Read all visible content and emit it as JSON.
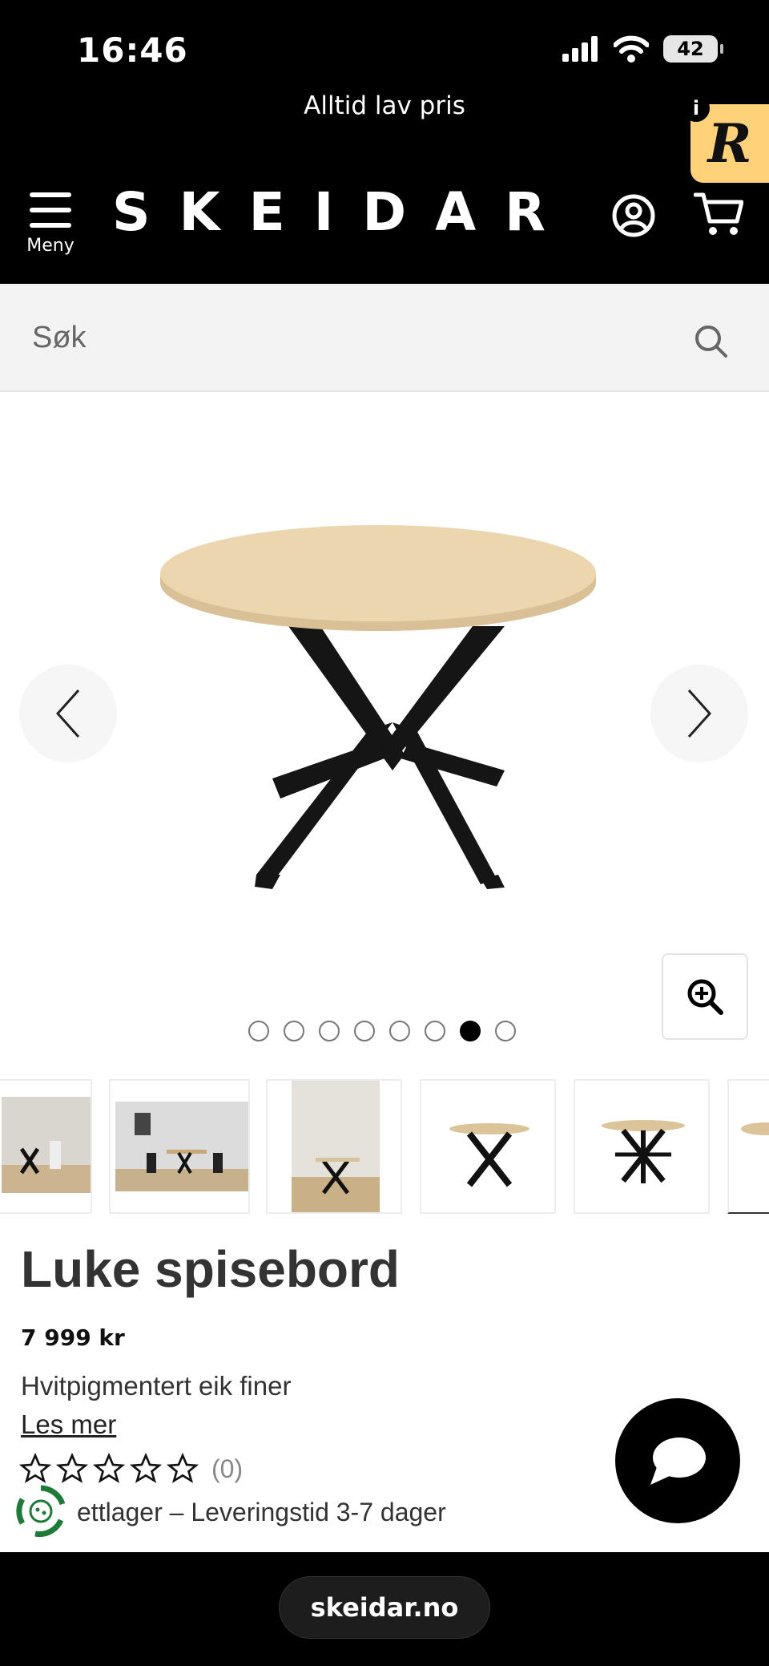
{
  "status_bar": {
    "time": "16:46",
    "battery": "42"
  },
  "header": {
    "promo_text": "Alltid lav pris",
    "logo_text": "SKEIDAR",
    "menu_label": "Meny",
    "badge_letter": "R",
    "badge_info": "i"
  },
  "search": {
    "placeholder": "Søk"
  },
  "gallery": {
    "dot_count": 8,
    "active_dot_index": 6
  },
  "product": {
    "title": "Luke spisebord",
    "price": "7 999 kr",
    "material": "Hvitpigmentert eik finer",
    "read_more": "Les mer",
    "rating_count": "(0)",
    "stock_text": "ettlager – Leveringstid 3-7 dager"
  },
  "browser": {
    "url": "skeidar.no"
  },
  "colors": {
    "header_bg": "#000000",
    "badge_bg": "#ffd27a",
    "table_top": "#ecd6b0",
    "table_legs": "#151515"
  }
}
